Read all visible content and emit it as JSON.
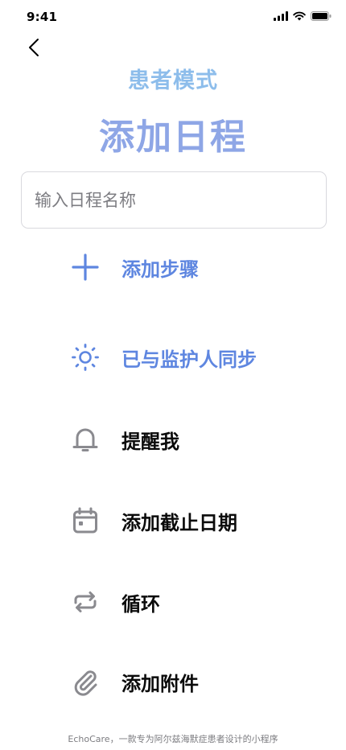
{
  "status_bar": {
    "time": "9:41",
    "icons": [
      "signal-icon",
      "wifi-icon",
      "battery-icon"
    ]
  },
  "header": {
    "back_icon": "chevron-left-icon",
    "mode_label": "患者模式",
    "title": "添加日程"
  },
  "form": {
    "name_placeholder": "输入日程名称",
    "name_value": ""
  },
  "actions": [
    {
      "id": "add-step",
      "icon": "plus-icon",
      "label": "添加步骤",
      "color": "#5E86E0"
    },
    {
      "id": "sync-guardian",
      "icon": "sun-icon",
      "label": "已与监护人同步",
      "color": "#5E86E0"
    },
    {
      "id": "remind-me",
      "icon": "bell-icon",
      "label": "提醒我",
      "color": "#0b0b0b"
    },
    {
      "id": "add-deadline",
      "icon": "calendar-icon",
      "label": "添加截止日期",
      "color": "#0b0b0b"
    },
    {
      "id": "repeat",
      "icon": "repeat-icon",
      "label": "循环",
      "color": "#0b0b0b"
    },
    {
      "id": "add-attachment",
      "icon": "paperclip-icon",
      "label": "添加附件",
      "color": "#0b0b0b"
    }
  ],
  "footer": {
    "text": "EchoCare，一款专为阿尔兹海默症患者设计的小程序"
  },
  "colors": {
    "mode_label": "#8DBDEB",
    "title": "#8EA6E6",
    "accent": "#5E86E0",
    "icon_gray": "#8a8a8f"
  }
}
